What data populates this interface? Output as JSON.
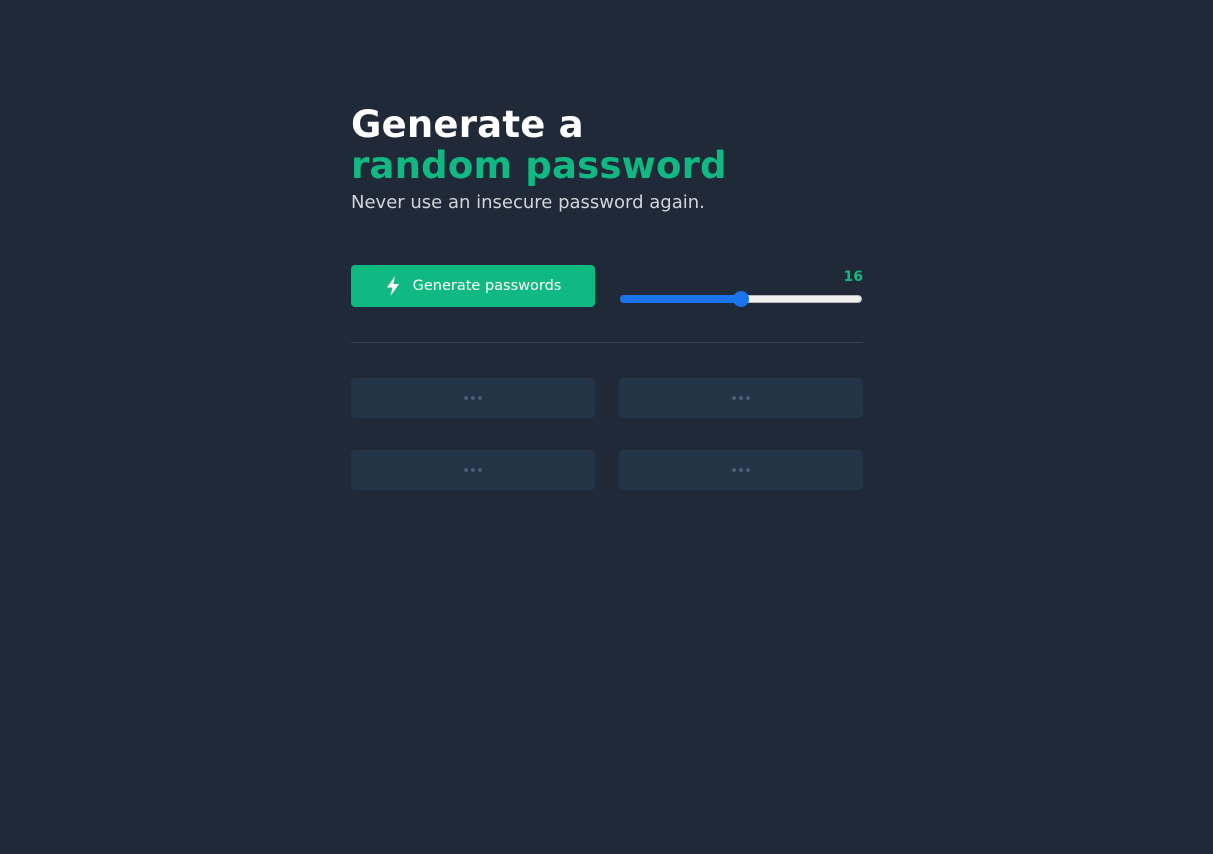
{
  "header": {
    "title_line1": "Generate a",
    "title_line2": "random password",
    "subtitle": "Never use an insecure password again."
  },
  "controls": {
    "generate_label": "Generate passwords",
    "generate_icon": "lightning-bolt-icon",
    "length_value": "16",
    "length_slider": {
      "value": 16,
      "min": 6,
      "max": 26
    }
  },
  "passwords": {
    "placeholder_icon": "ellipsis-icon",
    "items": [
      {
        "value": ""
      },
      {
        "value": ""
      },
      {
        "value": ""
      },
      {
        "value": ""
      }
    ]
  },
  "colors": {
    "background": "#1f2937",
    "accent": "#10b981",
    "slider_accent": "#1a73e8",
    "card": "#243447"
  }
}
